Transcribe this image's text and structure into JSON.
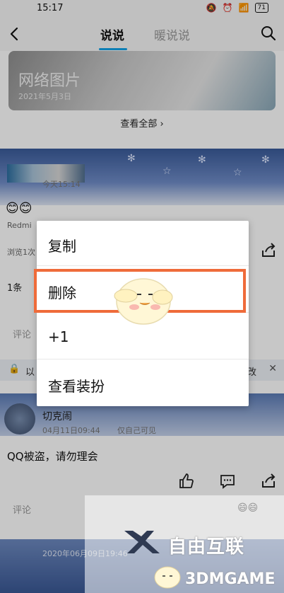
{
  "status_bar": {
    "time": "15:17",
    "battery": "71"
  },
  "nav": {
    "tabs": [
      {
        "label": "说说"
      },
      {
        "label": "暖说说"
      }
    ]
  },
  "photo_card": {
    "title": "网络图片",
    "date": "2021年5月3日"
  },
  "view_all": "查看全部 ›",
  "post1": {
    "time": "今天15:14",
    "emojis": "😊😊",
    "device": "Redmi",
    "views": "浏览1次",
    "comments_label": "1条",
    "comment_placeholder": "评论"
  },
  "privacy_bar": {
    "text_start": "以",
    "text_end": "改"
  },
  "post2": {
    "author": "切克闹",
    "time": "04月11日09:44",
    "visibility": "仅自己可见",
    "text": "QQ被盗，请勿理会",
    "comment_placeholder": "评论"
  },
  "post3": {
    "time": "2020年06月09日19:46"
  },
  "context_menu": {
    "items": [
      {
        "label": "复制"
      },
      {
        "label": "删除"
      },
      {
        "label": "+1"
      },
      {
        "label": "查看装扮"
      }
    ],
    "highlighted_index": 1,
    "highlight_color": "#ef6b3a"
  },
  "watermark": {
    "name": "自由互联",
    "site": "3DMGAME"
  },
  "colors": {
    "accent": "#13a3e8"
  }
}
